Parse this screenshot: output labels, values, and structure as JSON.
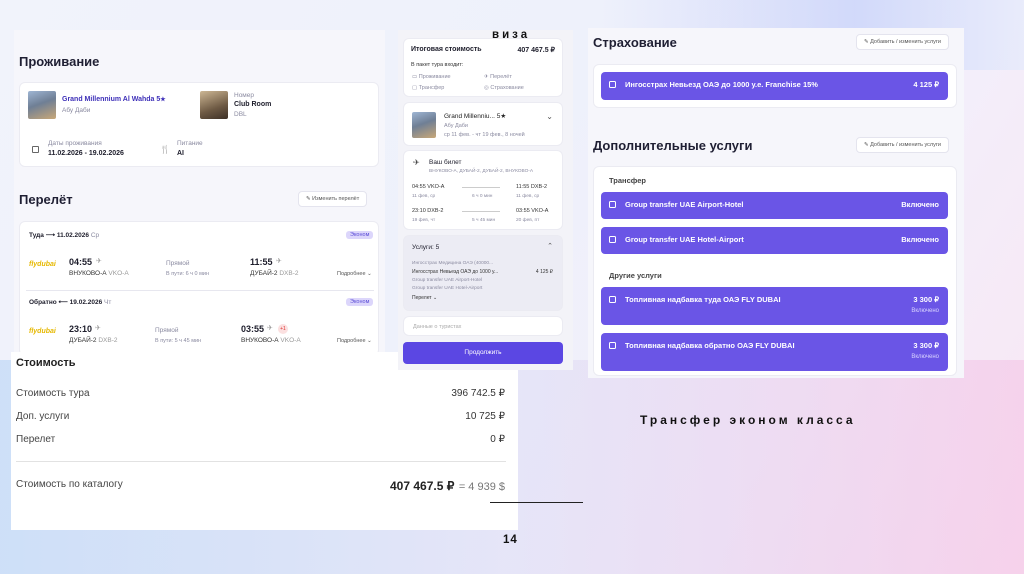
{
  "overlay": {
    "visa_label": "виза",
    "transfer_caption": "Трансфер эконом класса",
    "page_number": "14"
  },
  "accommodation": {
    "title": "Проживание",
    "hotel_name": "Grand Millennium Al Wahda 5",
    "hotel_city": "Абу Даби",
    "room_label": "Номер",
    "room_value": "Club Room",
    "room_sub": "DBL",
    "dates_label": "Даты проживания",
    "dates_value": "11.02.2026 - 19.02.2026",
    "meal_label": "Питание",
    "meal_value": "AI"
  },
  "flight": {
    "title": "Перелёт",
    "change_button": "Изменить перелёт",
    "there": {
      "header": "Туда ⟶ 11.02.2026",
      "weekday": "Ср",
      "class_tag": "Эконом",
      "airline": "flydubai",
      "dep_time": "04:55",
      "dep_place": "ВНУКОВО-А",
      "dep_code": "VKO-A",
      "type": "Прямой",
      "duration": "В пути: 6 ч 0 мин",
      "arr_time": "11:55",
      "arr_place": "ДУБАЙ-2",
      "arr_code": "DXB-2",
      "details": "Подробнее"
    },
    "back": {
      "header": "Обратно ⟵ 19.02.2026",
      "weekday": "Чт",
      "class_tag": "Эконом",
      "airline": "flydubai",
      "dep_time": "23:10",
      "dep_place": "ДУБАЙ-2",
      "dep_code": "DXB-2",
      "type": "Прямой",
      "duration": "В пути: 5 ч 45 мин",
      "arr_time": "03:55",
      "arr_badge": "+1",
      "arr_place": "ВНУКОВО-А",
      "arr_code": "VKO-A",
      "details": "Подробнее"
    }
  },
  "cost": {
    "title": "Стоимость",
    "rows": [
      {
        "label": "Стоимость тура",
        "value": "396 742.5 ₽"
      },
      {
        "label": "Доп. услуги",
        "value": "10 725 ₽"
      },
      {
        "label": "Перелет",
        "value": "0 ₽"
      }
    ],
    "catalog_label": "Стоимость по каталогу",
    "catalog_value": "407 467.5 ₽",
    "catalog_usd": "= 4 939 $"
  },
  "summary": {
    "total_label": "Итоговая стоимость",
    "total_value": "407 467.5 ₽",
    "includes_label": "В пакет тура входит:",
    "includes": [
      "Проживание",
      "Перелёт",
      "Трансфер",
      "Страхование"
    ],
    "hotel_name": "Grand Millenniu...",
    "hotel_stars": "5",
    "hotel_city": "Абу Даби",
    "hotel_dates": "ср 11 фев. - чт 19 фев., 8 ночей",
    "ticket_title": "Ваш билет",
    "ticket_route": "ВНУКОВО-А, ДУБАЙ-2, ДУБАЙ-2, ВНУКОВО-А",
    "leg1": {
      "dep": "04:55 VKO-A",
      "arr": "11:55 DXB-2",
      "dep_date": "11 фев, ср",
      "dur": "6 ч 0 мин",
      "arr_date": "11 фев, ср"
    },
    "leg2": {
      "dep": "23:10 DXB-2",
      "arr": "03:55 VKO-A",
      "dep_date": "19 фев, чт",
      "dur": "5 ч 45 мин",
      "arr_date": "20 фев, пт"
    },
    "services_title": "Услуги: 5",
    "services": [
      {
        "name": "Ингосстрах Медицина ОАЭ (40000...",
        "price": ""
      },
      {
        "name": "Ингосстрах Невьезд ОАЭ до 1000 у...",
        "price": "4 125 ₽"
      },
      {
        "name": "Group transfer UAE Airport-Hotel",
        "price": ""
      },
      {
        "name": "Group transfer UAE Hotel-Airport",
        "price": ""
      }
    ],
    "services_more": "Перелет",
    "tourists_placeholder": "Данные о туристах",
    "submit_button": "Продолжить"
  },
  "insurance": {
    "title": "Страхование",
    "edit_button": "Добавить / изменить услуги",
    "item_label": "Ингосстрах Невьезд ОАЭ до 1000 у.е. Franchise 15%",
    "item_value": "4 125 ₽"
  },
  "extra": {
    "title": "Дополнительные услуги",
    "edit_button": "Добавить / изменить услуги",
    "transfer_heading": "Трансфер",
    "transfers": [
      {
        "label": "Group transfer UAE Airport-Hotel",
        "value": "Включено"
      },
      {
        "label": "Group transfer UAE Hotel-Airport",
        "value": "Включено"
      }
    ],
    "other_heading": "Другие услуги",
    "others": [
      {
        "label": "Топливная надбавка туда ОАЭ FLY DUBAI",
        "value": "3 300 ₽",
        "sub": "Включено"
      },
      {
        "label": "Топливная надбавка обратно ОАЭ FLY DUBAI",
        "value": "3 300 ₽",
        "sub": "Включено"
      }
    ]
  }
}
